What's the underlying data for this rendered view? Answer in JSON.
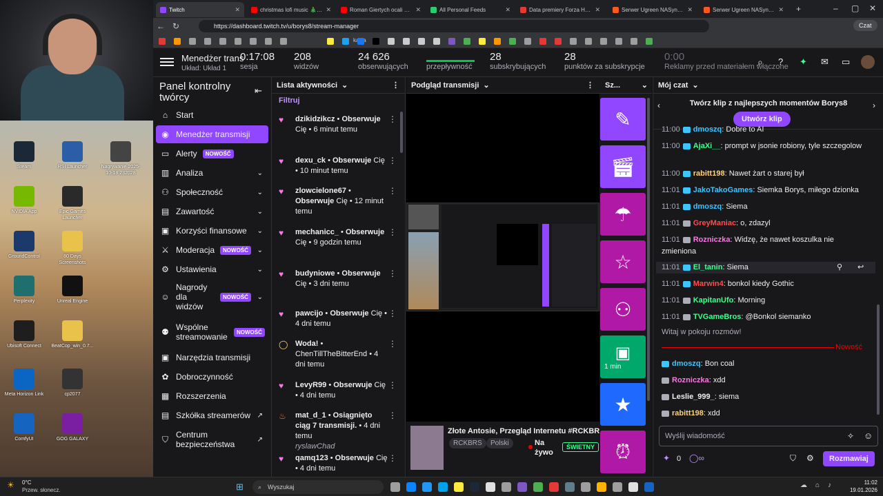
{
  "desktop": {
    "icons": [
      {
        "label": "Steam",
        "color": "#1b2838"
      },
      {
        "label": "RSI Launcher",
        "color": "#2b5ea7"
      },
      {
        "label": "Nagrywanie 2025-10-18 232028",
        "color": "#444"
      },
      {
        "label": "NVIDIA App",
        "color": "#76b900"
      },
      {
        "label": "Epic Games Launcher",
        "color": "#2a2a2a"
      },
      {
        "label": "GroundControl",
        "color": "#1b3a6b"
      },
      {
        "label": "80 Days Screenshots",
        "color": "#e8c24a"
      },
      {
        "label": "Perplexity",
        "color": "#1f6f6f"
      },
      {
        "label": "Unreal Engine",
        "color": "#111"
      },
      {
        "label": "Ubisoft Connect",
        "color": "#1e1e1e"
      },
      {
        "label": "BeatCop_win_0.7...",
        "color": "#e8c24a"
      },
      {
        "label": "Meta Horizon Link",
        "color": "#0a66c2"
      },
      {
        "label": "cp2077",
        "color": "#333"
      },
      {
        "label": "ComfyUI",
        "color": "#1565c0"
      },
      {
        "label": "GOG GALAXY",
        "color": "#7b1fa2"
      }
    ]
  },
  "browser": {
    "tabs": [
      {
        "label": "Twitch",
        "color": "#9147ff"
      },
      {
        "label": "christmas lofi music 🎄 chill",
        "color": "#ff0000"
      },
      {
        "label": "Roman Giertych ocali wasze",
        "color": "#ff0000"
      },
      {
        "label": "All Personal Feeds",
        "color": "#2ecc71"
      },
      {
        "label": "Data premiery Forza Horizon",
        "color": "#e53935"
      },
      {
        "label": "Serwer Ugreen NASync DXP",
        "color": "#ff5722"
      },
      {
        "label": "Serwer Ugreen NASync DXP",
        "color": "#ff5722"
      }
    ],
    "url": "https://dashboard.twitch.tv/u/borys8/stream-manager",
    "bookmark_kawa": "kawa",
    "profile_label": "Czat"
  },
  "topbar": {
    "title": "Menedżer trans",
    "subtitle": "Układ: Układ 1",
    "stats": [
      {
        "value": "0:17:08",
        "label": "sesja"
      },
      {
        "value": "208",
        "label": "widzów"
      },
      {
        "value": "24 626",
        "label": "obserwujących"
      },
      {
        "value": "",
        "label": "przepływność"
      },
      {
        "value": "28",
        "label": "subskrybujących"
      },
      {
        "value": "28",
        "label": "punktów za subskrypcje"
      },
      {
        "value": "0:00",
        "label": "Reklamy przed materiałem włączone"
      }
    ]
  },
  "sidebar": {
    "title": "Panel kontrolny twórcy",
    "new_badge": "NOWOŚĆ",
    "items": [
      {
        "label": "Start",
        "icon": "home-icon"
      },
      {
        "label": "Menedżer transmisji",
        "icon": "broadcast-icon"
      },
      {
        "label": "Alerty",
        "icon": "alert-icon"
      },
      {
        "label": "Analiza",
        "icon": "analytics-icon"
      },
      {
        "label": "Społeczność",
        "icon": "community-icon"
      },
      {
        "label": "Zawartość",
        "icon": "content-icon"
      },
      {
        "label": "Korzyści finansowe",
        "icon": "monetization-icon"
      },
      {
        "label": "Moderacja",
        "icon": "moderation-icon"
      },
      {
        "label": "Ustawienia",
        "icon": "settings-icon"
      },
      {
        "label": "Nagrody dla widzów",
        "icon": "rewards-icon"
      },
      {
        "label": "Wspólne streamowanie",
        "icon": "collab-icon"
      },
      {
        "label": "Narzędzia transmisji",
        "icon": "tools-icon"
      },
      {
        "label": "Dobroczynność",
        "icon": "charity-icon"
      },
      {
        "label": "Rozszerzenia",
        "icon": "extensions-icon"
      },
      {
        "label": "Szkółka streamerów",
        "icon": "academy-icon"
      },
      {
        "label": "Centrum bezpieczeństwa",
        "icon": "safety-icon"
      }
    ]
  },
  "activity": {
    "title": "Lista aktywności",
    "filter": "Filtruj",
    "items": [
      {
        "user": "dzikidzikcz",
        "action": "Obserwuje",
        "rest": "Cię • 6 minut temu"
      },
      {
        "user": "dexu_ck",
        "action": "Obserwuje",
        "rest": "Cię • 10 minut temu"
      },
      {
        "user": "zlowcielone67",
        "action": "Obserwuje",
        "rest": "Cię • 12 minut temu"
      },
      {
        "user": "mechanicc_",
        "action": "Obserwuje",
        "rest": "Cię • 9 godzin temu"
      },
      {
        "user": "budyniowe",
        "action": "Obserwuje",
        "rest": "Cię • 3 dni temu"
      },
      {
        "user": "pawcijo",
        "action": "Obserwuje",
        "rest": "Cię • 4 dni temu"
      },
      {
        "user": "Woda!",
        "action": "",
        "rest": "ChenTillTheBitterEnd • 4 dni temu"
      },
      {
        "user": "LevyR99",
        "action": "Obserwuje",
        "rest": "Cię • 4 dni temu"
      },
      {
        "user": "mat_d_1",
        "action": "Osiągnięto ciąg 7 transmisji.",
        "rest": "• 4 dni temu",
        "extra": "ryslawChad"
      },
      {
        "user": "qamq123",
        "action": "Obserwuje",
        "rest": "Cię • 4 dni temu"
      }
    ]
  },
  "preview": {
    "title": "Podgląd transmisji",
    "stream_title": "Złote Antosie, Przegląd Internetu #RCKBR",
    "tag1": "RCKBRS",
    "tag2": "Polski",
    "live_label": "Na żywo",
    "status": "ŚWIETNY"
  },
  "quick": {
    "title": "Sz...",
    "timer": "1 min"
  },
  "chat": {
    "title": "Mój czat",
    "clip_text": "Twórz klip z najlepszych momentów Borys8",
    "clip_button": "Utwórz klip",
    "messages": [
      {
        "time": "11:00",
        "user": "dmoszq",
        "color": "#3dc5ff",
        "text": "Dobre to AI"
      },
      {
        "time": "11:00",
        "user": "AjaXi__",
        "color": "#3dff8f",
        "text": "prompt w jsonie robiony, tyle szczegolow"
      },
      {
        "time": "11:00",
        "user": "rabitt198",
        "color": "#ffd37a",
        "text": "Nawet żart o starej był"
      },
      {
        "time": "11:01",
        "user": "JakoTakoGames",
        "color": "#3dc5ff",
        "text": "Siemka Borys, miłego dzionka"
      },
      {
        "time": "11:01",
        "user": "dmoszq",
        "color": "#3dc5ff",
        "text": "Siema"
      },
      {
        "time": "11:01",
        "user": "GreyManiac",
        "color": "#ff4d4d",
        "text": "o, zdazyl"
      },
      {
        "time": "11:01",
        "user": "Rozniczka",
        "color": "#ff75e6",
        "text": "Widzę, że nawet koszulka nie zmieniona"
      },
      {
        "time": "11:01",
        "user": "El_tanin",
        "color": "#3dff8f",
        "text": "Siema"
      },
      {
        "time": "11:01",
        "user": "Marwin4",
        "color": "#ff4d4d",
        "text": "bonkol kiedy Gothic"
      },
      {
        "time": "11:01",
        "user": "KapitanUfo",
        "color": "#3dff8f",
        "text": "Morning"
      },
      {
        "time": "11:01",
        "user": "TVGameBros",
        "color": "#3dff8f",
        "text": "@Bonkol siemanko"
      }
    ],
    "welcome": "Witaj w pokoju rozmów!",
    "new_label": "Nowość",
    "new_messages": [
      {
        "user": "dmoszq",
        "color": "#3dc5ff",
        "text": "Bon coal"
      },
      {
        "user": "Rozniczka",
        "color": "#ff75e6",
        "text": "xdd"
      },
      {
        "user": "Leslie_999_",
        "color": "#efeff1",
        "text": "siema"
      },
      {
        "user": "rabitt198",
        "color": "#ffd37a",
        "text": "xdd"
      }
    ],
    "placeholder": "Wyślij wiadomość",
    "points": "0",
    "send": "Rozmawiaj"
  },
  "taskbar": {
    "weather_temp": "0°C",
    "weather_desc": "Przew. słonecz.",
    "search": "Wyszukaj",
    "time": "11:02",
    "date": "19.01.2026"
  }
}
